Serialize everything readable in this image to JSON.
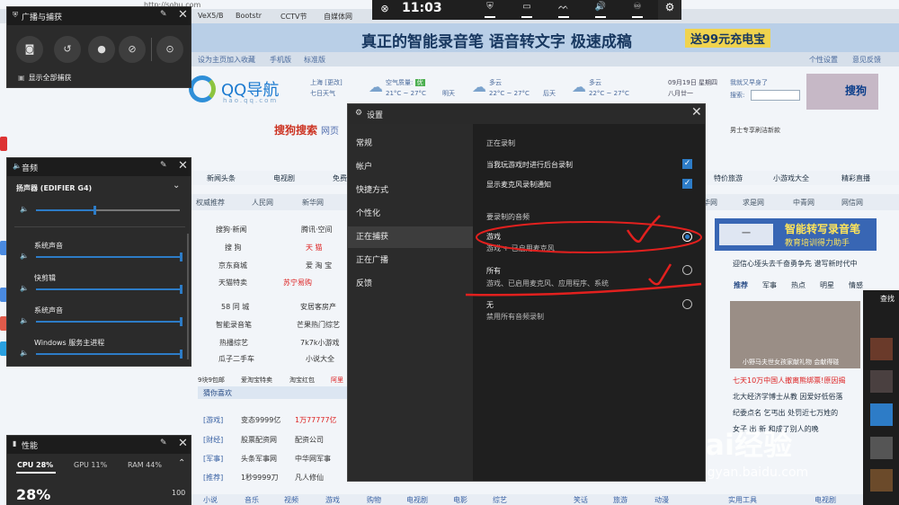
{
  "background": {
    "bookmarks": [
      "VeX5/B",
      "Bootstr",
      "CCTV节",
      "自媒体网",
      "http://sohu.com"
    ],
    "banner": {
      "text": "真正的智能录音笔 语音转文字 极速成稿",
      "button": "送99元充电宝"
    },
    "nav_links": [
      "设为主页",
      "加入收藏",
      "手机版",
      "标准版"
    ],
    "nav_right": [
      "个性设置",
      "意见反馈"
    ],
    "logo": {
      "text": "QQ导航",
      "sub": "hao.qq.com"
    },
    "weather": [
      {
        "city": "上海 [更改]",
        "desc": "七日天气"
      },
      {
        "title": "空气质量:",
        "badge": "优",
        "temp": "21°C ~ 27°C",
        "desc": "明天"
      },
      {
        "title": "多云",
        "temp": "22°C ~ 27°C",
        "desc": "后天"
      },
      {
        "title": "多云",
        "temp": "22°C ~ 27°C"
      }
    ],
    "date": {
      "line1": "09月19日 星期四",
      "line2": "八月廿一"
    },
    "search_hint": "我就又早身了",
    "search_label": "搜索:",
    "brand_right": "搜狗",
    "sogou": {
      "brand": "搜狗搜索",
      "sub": "网页"
    },
    "right_note": "男士专享刷洁新款",
    "tabs2": [
      "新闻头条",
      "电视剧",
      "免费",
      "特价旅游",
      "小游戏大全",
      "精彩直播"
    ],
    "row3": [
      "权威推荐",
      "人民网",
      "新华网",
      "华网",
      "求是网",
      "中青网",
      "网信网"
    ],
    "grid": [
      [
        "搜狗·新闻",
        "腾讯·空间"
      ],
      [
        "搜 狗",
        "天 猫"
      ],
      [
        "京东商城",
        "爱 淘 宝"
      ],
      [
        "天猫特卖",
        "苏宁易购"
      ],
      [
        "58 同 城",
        "安居客房产"
      ],
      [
        "智能录音笔",
        "芒果热门综艺"
      ],
      [
        "热播综艺",
        "7k7k小游戏"
      ],
      [
        "瓜子二手车",
        "小说大全"
      ]
    ],
    "small_row": [
      "9块9包邮",
      "爱淘宝特卖",
      "淘宝红包",
      "阿里"
    ],
    "ad": {
      "inner": "一",
      "t1": "智能转写录音笔",
      "t2": "教育培训得力助手"
    },
    "headline_top": "迎信心垭头去千奋勇争先 谱写新时代中",
    "news_tabs": [
      "推荐",
      "军事",
      "热点",
      "明星",
      "情感"
    ],
    "news_caption": "小野马夫世女孩家献礼物 会献得碰",
    "news": [
      "七天10万中国人撤离熊绑票!原因揭",
      "北大经济学博士从教 因爱好低俗落",
      "纪委点名 乞丐出 处罚近七万姓的",
      "女子 出 新 和成了别人的晚"
    ],
    "guess_title": "猜你喜欢",
    "guess_rows": [
      [
        "[游戏]",
        "变态9999亿",
        "1万77777亿"
      ],
      [
        "[财经]",
        "股票配资网",
        "配资公司"
      ],
      [
        "[军事]",
        "头条军事网",
        "中华网军事"
      ],
      [
        "[推荐]",
        "1秒9999刀",
        "凡人修仙"
      ]
    ],
    "bottom_links": [
      "小说",
      "音乐",
      "视频",
      "游戏",
      "购物",
      "电视剧",
      "电影",
      "综艺",
      "笑话",
      "旅游",
      "动漫",
      "实用工具",
      "电视剧"
    ],
    "thumbs_title": "查找",
    "watermark": "Bai经验",
    "watermark_url": "jingyan.baidu.com"
  },
  "gamebar": {
    "time": "11:03",
    "icons": [
      "widget-menu-icon",
      "capture-icon",
      "performance-icon",
      "audio-icon",
      "social-icon"
    ],
    "colors": {
      "bar": "#1f1f1f",
      "accent": "#2d7cc7"
    }
  },
  "capture_widget": {
    "title": "广播与捕获",
    "buttons": [
      "screenshot",
      "record-last",
      "record",
      "mic",
      "broadcast"
    ],
    "show_all": "显示全部捕获"
  },
  "audio_widget": {
    "title": "音频",
    "device": "扬声器 (EDIFIER G4)",
    "master_level": 0.4,
    "apps": [
      {
        "name": "系统声音",
        "level": 1.0
      },
      {
        "name": "快剪辑",
        "level": 1.0
      },
      {
        "name": "系统声音",
        "level": 1.0
      },
      {
        "name": "Windows 服务主进程",
        "level": 1.0
      }
    ]
  },
  "performance_widget": {
    "title": "性能",
    "tabs": [
      "CPU 28%",
      "GPU 11%",
      "RAM 44%"
    ],
    "big_value": "28%",
    "max_label": "100"
  },
  "settings": {
    "title": "设置",
    "sidebar": [
      "常规",
      "帐户",
      "快捷方式",
      "个性化",
      "正在捕获",
      "正在广播",
      "反馈"
    ],
    "active_index": 4,
    "section_recording": "正在录制",
    "check_bg_record": "当我玩游戏时进行后台录制",
    "check_mic_notify": "显示麦克风录制通知",
    "section_audio": "要录制的音频",
    "options": [
      {
        "label": "游戏",
        "desc": "游戏 + 已启用麦克风",
        "selected": true
      },
      {
        "label": "所有",
        "desc": "游戏、已启用麦克风、应用程序、系统",
        "selected": false
      },
      {
        "label": "无",
        "desc": "禁用所有音频录制",
        "selected": false
      }
    ]
  }
}
